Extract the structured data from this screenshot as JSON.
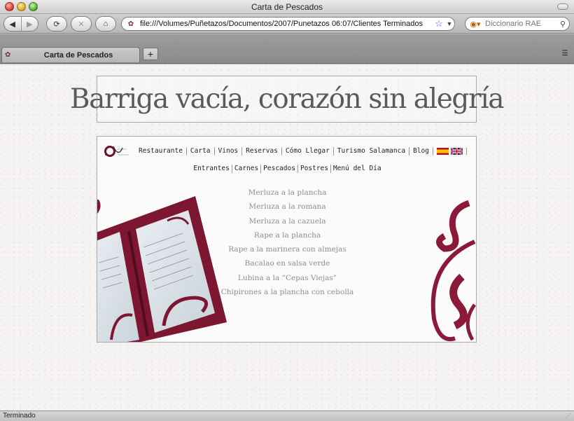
{
  "window": {
    "title": "Carta de Pescados"
  },
  "toolbar": {
    "url": "file:///Volumes/Puñetazos/Documentos/2007/Punetazos 06:07/Clientes Terminados",
    "search_placeholder": "Diccionario RAE"
  },
  "tabs": [
    {
      "label": "Carta de Pescados"
    }
  ],
  "page": {
    "headline": "Barriga vacía, corazón sin alegría",
    "main_nav": [
      "Restaurante",
      "Carta",
      "Vinos",
      "Reservas",
      "Cómo Llegar",
      "Turismo Salamanca",
      "Blog"
    ],
    "sub_nav": [
      "Entrantes",
      "Carnes",
      "Pescados",
      "Postres",
      "Menú del Día"
    ],
    "dishes": [
      "Merluza a la plancha",
      "Merluza a la romana",
      "Merluza a la cazuela",
      "Rape a la plancha",
      "Rape a la marinera con almejas",
      "Bacalao en salsa verde",
      "Lubina a la “Cepas Viejas”",
      "Chipirones a la plancha con cebolla"
    ]
  },
  "status": {
    "text": "Terminado"
  },
  "colors": {
    "brand": "#8b1a3a",
    "headline": "#5a5a5a",
    "dish_text": "#8e8e8e"
  }
}
